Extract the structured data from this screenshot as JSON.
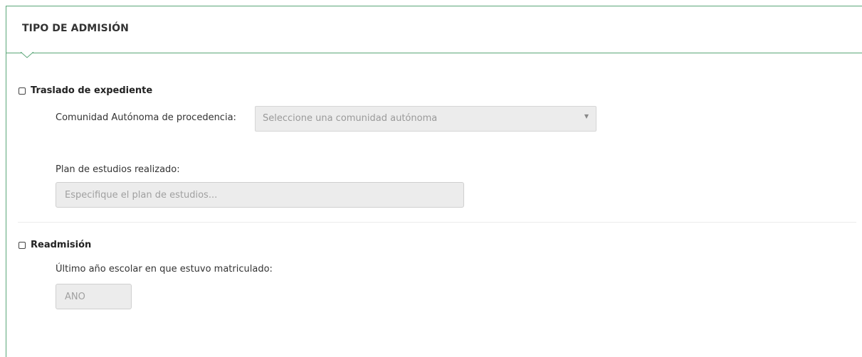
{
  "panel": {
    "title": "TIPO DE ADMISIÓN"
  },
  "traslado": {
    "checkbox_label": "Traslado de expediente",
    "checked": false,
    "comunidad_label": "Comunidad Autónoma de procedencia:",
    "comunidad_select_value": "Seleccione una comunidad autónoma",
    "plan_label": "Plan de estudios realizado:",
    "plan_placeholder": "Especifique el plan de estudios..."
  },
  "readmision": {
    "checkbox_label": "Readmisión",
    "checked": false,
    "year_label": "Último año escolar en que estuvo matriculado:",
    "year_placeholder": "AÑO"
  },
  "colors": {
    "accent": "#5aa678",
    "field_bg": "#ececec"
  }
}
